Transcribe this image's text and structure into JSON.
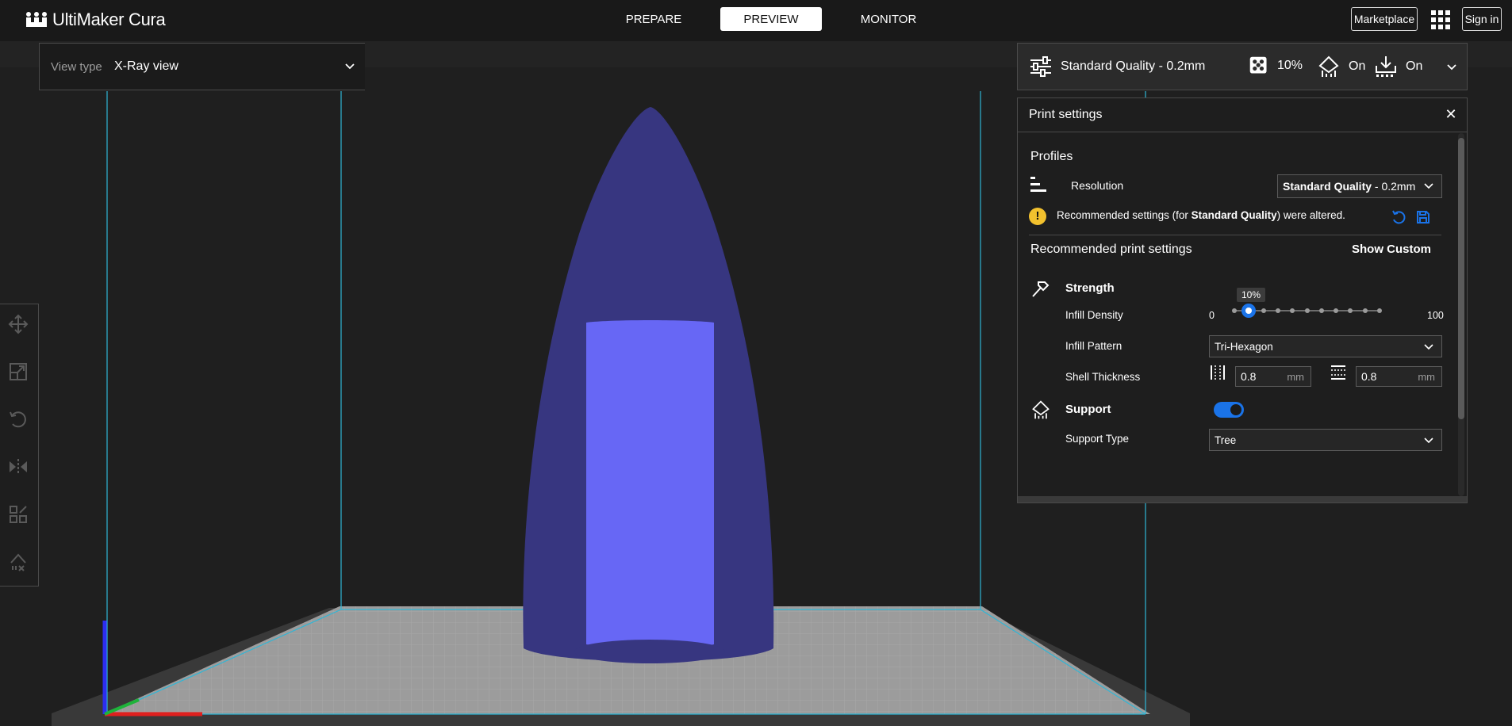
{
  "app": {
    "logo_text": "UltiMaker Cura",
    "tabs": [
      {
        "label": "PREPARE",
        "active": false
      },
      {
        "label": "PREVIEW",
        "active": true
      },
      {
        "label": "MONITOR",
        "active": false
      }
    ],
    "marketplace_label": "Marketplace",
    "signin_label": "Sign in"
  },
  "view_type": {
    "label": "View type",
    "value": "X-Ray view"
  },
  "toolbar": {
    "tools": [
      "move-icon",
      "scale-icon",
      "rotate-icon",
      "mirror-icon",
      "per-model-settings-icon",
      "support-blocker-icon"
    ]
  },
  "quality_bar": {
    "profile": "Standard Quality - 0.2mm",
    "infill": "10%",
    "support": "On",
    "adhesion": "On"
  },
  "print_settings": {
    "title": "Print settings",
    "profiles_heading": "Profiles",
    "resolution_label": "Resolution",
    "resolution_value_bold": "Standard Quality",
    "resolution_value_rest": " - 0.2mm",
    "warning_prefix": "Recommended settings (for ",
    "warning_bold": "Standard Quality",
    "warning_suffix": ") were altered.",
    "recommended_heading": "Recommended print settings",
    "show_custom_label": "Show Custom",
    "strength_heading": "Strength",
    "infill_density_label": "Infill Density",
    "infill_density_value": "10%",
    "infill_density_fraction": 0.1,
    "slider_min": "0",
    "slider_max": "100",
    "infill_pattern_label": "Infill Pattern",
    "infill_pattern_value": "Tri-Hexagon",
    "shell_thickness_label": "Shell Thickness",
    "wall_thickness": "0.8",
    "top_bottom_thickness": "0.8",
    "unit": "mm",
    "support_heading": "Support",
    "support_enabled": true,
    "support_type_label": "Support Type",
    "support_type_value": "Tree"
  },
  "colors": {
    "accent": "#1a73e8",
    "model_outer": "#373680",
    "model_inner": "#6767f5",
    "build_volume": "#2fb6d6",
    "warning": "#f2c12e"
  }
}
